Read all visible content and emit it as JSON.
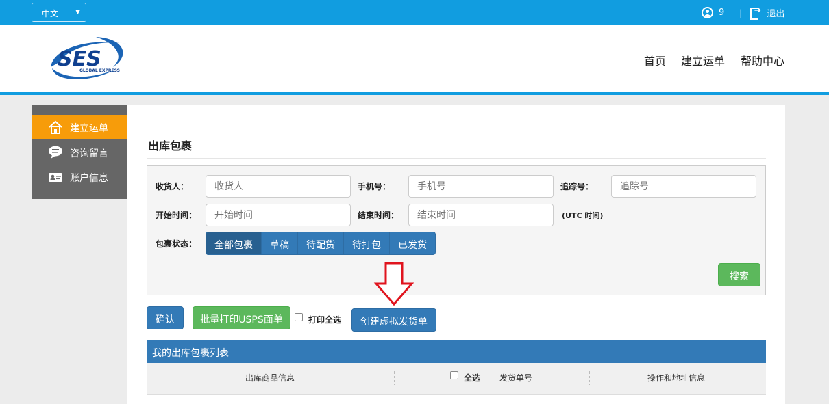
{
  "topbar": {
    "language": "中文",
    "user_count": "9",
    "separator": "|",
    "logout_label": "退出"
  },
  "header": {
    "logo_text": "SES",
    "logo_sub": "GLOBAL EXPRESS",
    "nav": [
      {
        "label": "首页"
      },
      {
        "label": "建立运单"
      },
      {
        "label": "帮助中心"
      }
    ]
  },
  "sidebar": {
    "items": [
      {
        "label": "建立运单",
        "active": true
      },
      {
        "label": "咨询留言",
        "active": false
      },
      {
        "label": "账户信息",
        "active": false
      }
    ]
  },
  "main": {
    "title": "出库包裹",
    "filters": {
      "receiver_label": "收货人：",
      "receiver_placeholder": "收货人",
      "phone_label": "手机号：",
      "phone_placeholder": "手机号",
      "tracking_label": "追踪号：",
      "tracking_placeholder": "追踪号",
      "start_label": "开始时间：",
      "start_placeholder": "开始时间",
      "end_label": "结束时间：",
      "end_placeholder": "结束时间",
      "utc_note": "(UTC 时间)",
      "status_label": "包裹状态：",
      "status_options": [
        "全部包裹",
        "草稿",
        "待配货",
        "待打包",
        "已发货"
      ],
      "search_button": "搜索"
    },
    "actions": {
      "confirm": "确认",
      "batch_print": "批量打印USPS面单",
      "print_all_label": "打印全选",
      "create_virtual": "创建虚拟发货单"
    },
    "list": {
      "title": "我的出库包裹列表",
      "columns": {
        "goods": "出库商品信息",
        "select_all": "全选",
        "shipment_no": "发货单号",
        "ops": "操作和地址信息"
      }
    }
  },
  "colors": {
    "brand_blue": "#119de0",
    "active_orange": "#f79c0a",
    "primary": "#337ab7",
    "success": "#5cb85c",
    "arrow_red": "#e0141e"
  }
}
